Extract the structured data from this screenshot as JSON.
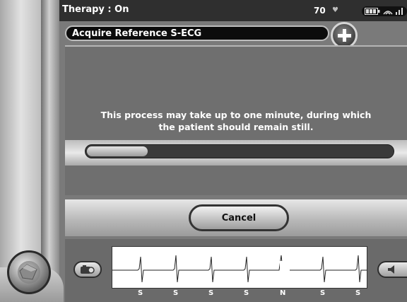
{
  "status": {
    "therapy_label": "Therapy : On",
    "heart_rate": "70",
    "heart_icon": "heart-icon",
    "battery_icon": "battery-icon",
    "signal_icon": "signal-icon"
  },
  "header": {
    "title": "Acquire Reference S-ECG",
    "add_icon": "plus-icon"
  },
  "main": {
    "message_line1": "This process may take up to one minute, during which",
    "message_line2": "the patient should remain still.",
    "progress_fraction": 0.2
  },
  "actions": {
    "cancel_label": "Cancel"
  },
  "ecg": {
    "beat_labels": [
      "S",
      "S",
      "S",
      "S",
      "N",
      "S",
      "S"
    ],
    "camera_icon": "camera-icon",
    "speaker_icon": "speaker-icon"
  },
  "nav": {
    "home_icon": "home-icon"
  }
}
